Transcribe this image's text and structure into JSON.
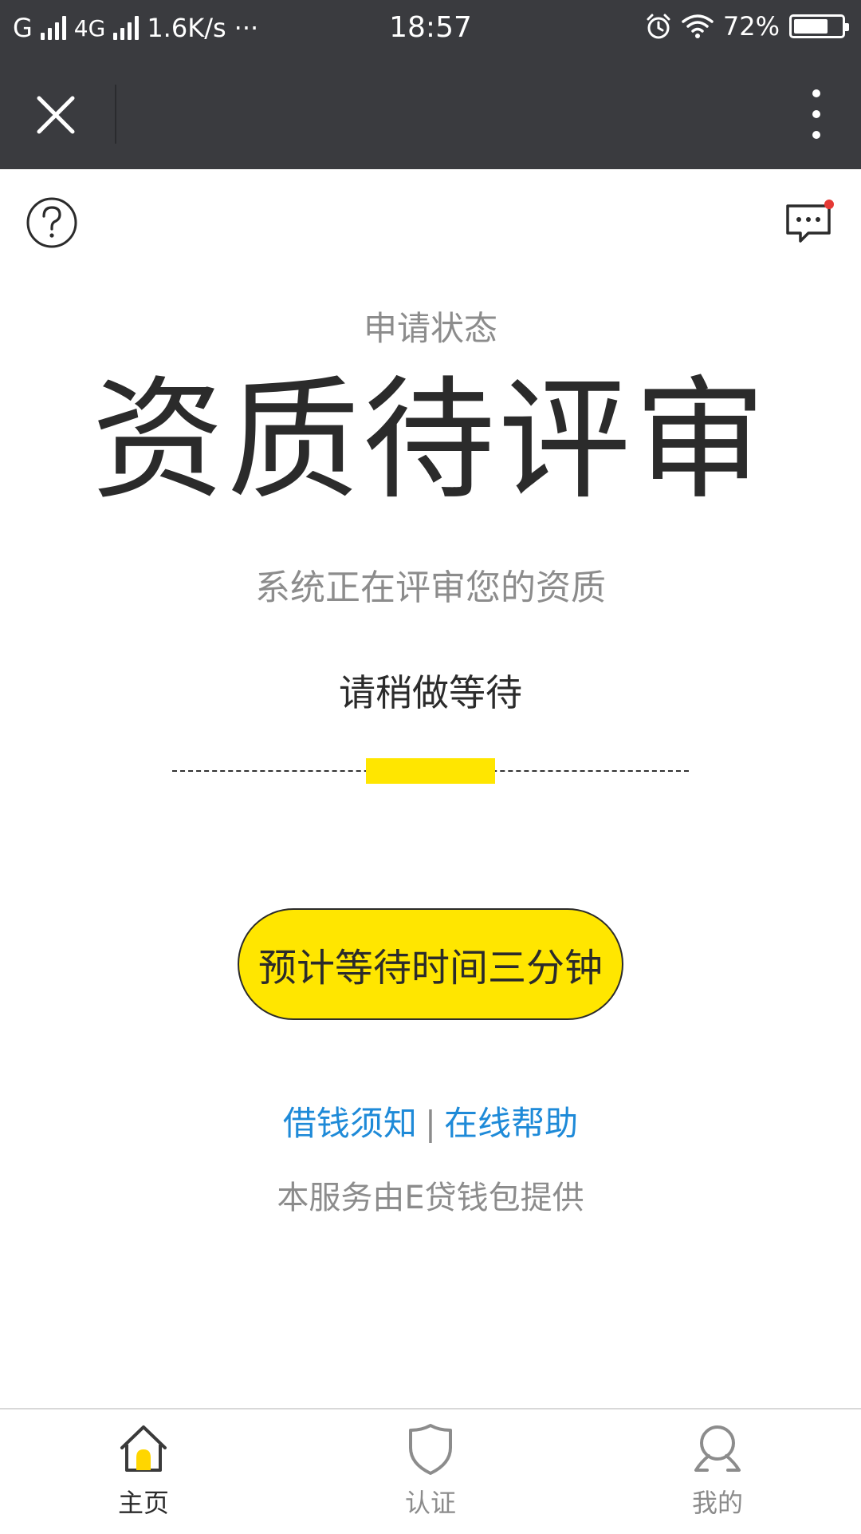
{
  "status_bar": {
    "carrier_1": "G",
    "carrier_2": "4G",
    "speed": "1.6K/s",
    "more": "···",
    "time": "18:57",
    "battery": "72%",
    "battery_level": 0.72
  },
  "application": {
    "status_label": "申请状态",
    "status_title": "资质待评审",
    "status_desc": "系统正在评审您的资质",
    "wait_text": "请稍做等待",
    "button_label": "预计等待时间三分钟",
    "links": {
      "loan_notice": "借钱须知",
      "separator": "|",
      "online_help": "在线帮助"
    },
    "provider": "本服务由E贷钱包提供"
  },
  "tabs": [
    {
      "label": "主页"
    },
    {
      "label": "认证"
    },
    {
      "label": "我的"
    }
  ],
  "colors": {
    "accent": "#ffe600",
    "link": "#1e8ad8",
    "nav_bg": "#3a3b3f",
    "badge": "#e53935"
  }
}
